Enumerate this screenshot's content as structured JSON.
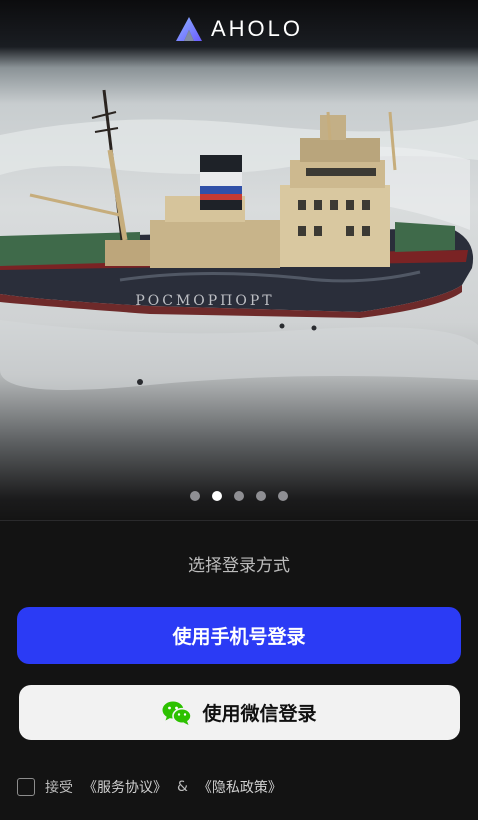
{
  "brand": {
    "name": "AHOLO"
  },
  "hero": {
    "ship_hull_text": "РОСМОРПОРТ",
    "carousel": {
      "count": 5,
      "active_index": 1
    }
  },
  "login": {
    "subtitle": "选择登录方式",
    "phone_button": "使用手机号登录",
    "wechat_button": "使用微信登录"
  },
  "agreement": {
    "accept": "接受",
    "service_link": "《服务协议》",
    "and": "&",
    "privacy_link": "《隐私政策》",
    "checked": false
  },
  "colors": {
    "background": "#131313",
    "primary_button": "#2b3bf5",
    "secondary_button": "#f2f2f2",
    "wechat_green": "#2dc100"
  },
  "icons": {
    "brand": "aholo-logo-icon",
    "wechat": "wechat-icon"
  }
}
